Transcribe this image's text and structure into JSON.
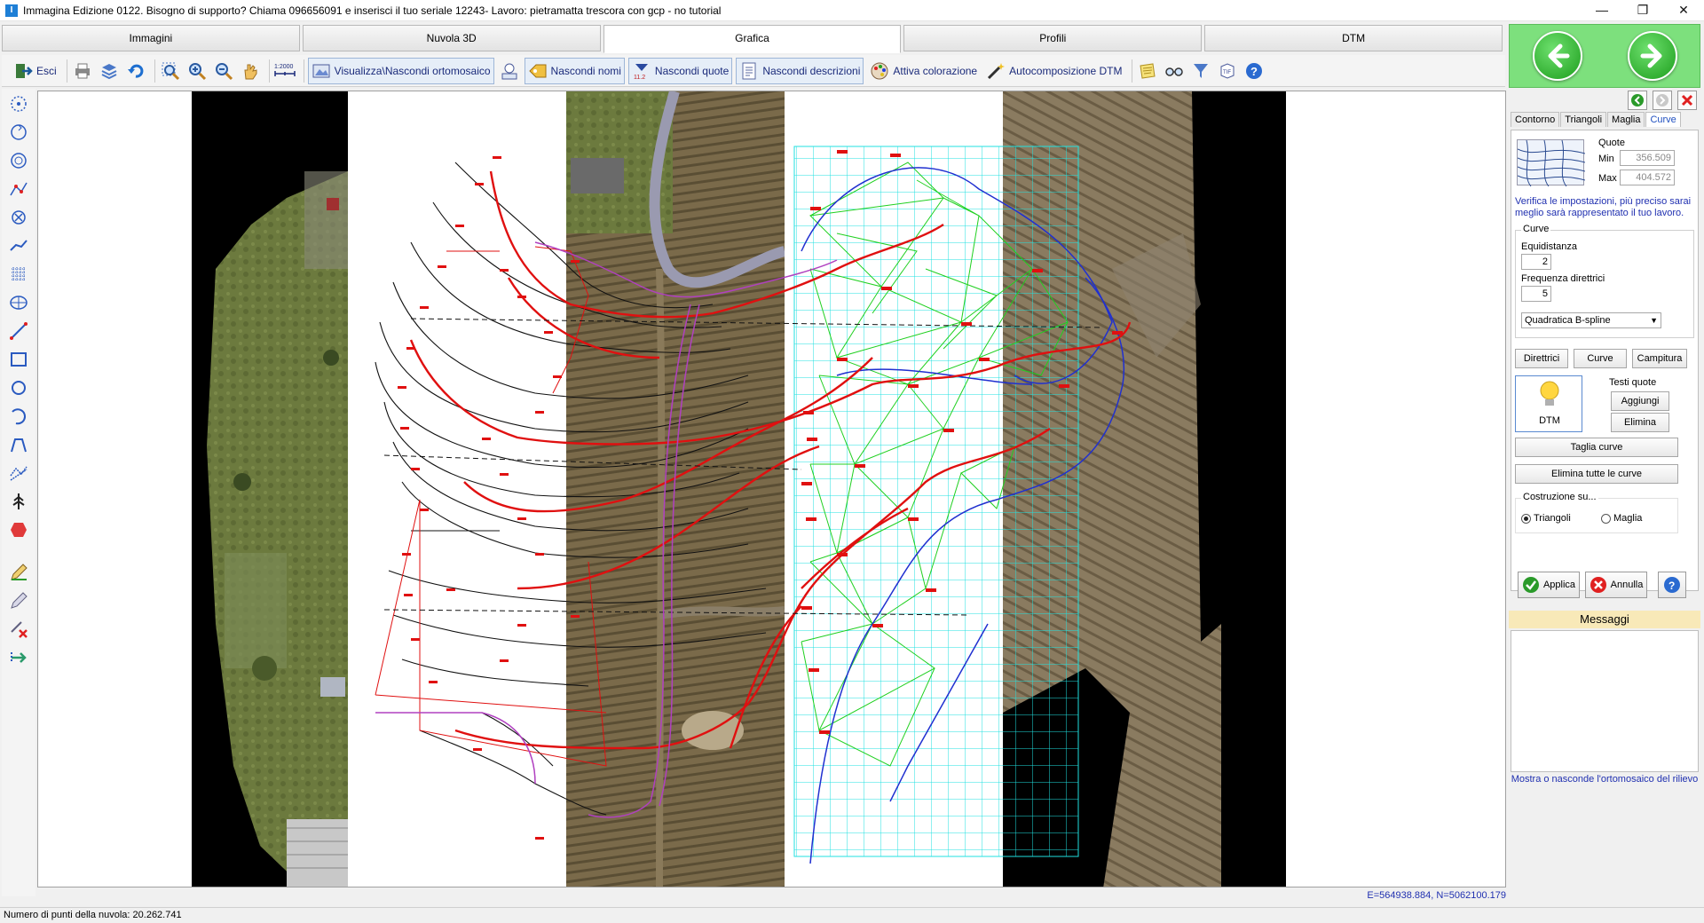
{
  "window": {
    "title": "Immagina  Edizione 0122. Bisogno di supporto? Chiama 096656091 e inserisci il tuo seriale 12243- Lavoro: pietramatta trescora con gcp - no tutorial",
    "minimize": "—",
    "maximize": "❐",
    "close": "✕"
  },
  "tabs": [
    "Immagini",
    "Nuvola 3D",
    "Grafica",
    "Profili",
    "DTM"
  ],
  "toolbar": {
    "exit": "Esci",
    "toggle_ortho": "Visualizza\\Nascondi ortomosaico",
    "hide_names": "Nascondi nomi",
    "hide_quotes": "Nascondi quote",
    "hide_desc": "Nascondi descrizioni",
    "coloring": "Attiva colorazione",
    "autocomp": "Autocomposizione DTM",
    "scale_label": "1:2000"
  },
  "right_panel": {
    "subtabs": [
      "Contorno",
      "Triangoli",
      "Maglia",
      "Curve"
    ],
    "active_subtab": "Curve",
    "quote_title": "Quote",
    "min_label": "Min",
    "min_value": "356.509",
    "max_label": "Max",
    "max_value": "404.572",
    "info": "Verifica le impostazioni, più preciso sarai meglio sarà rappresentato il tuo lavoro.",
    "curve_group": "Curve",
    "equidistanza_label": "Equidistanza",
    "equidistanza_value": "2",
    "frequenza_label": "Frequenza direttrici",
    "frequenza_value": "5",
    "spline_option": "Quadratica B-spline",
    "btn_direttrici": "Direttrici",
    "btn_curve": "Curve",
    "btn_campitura": "Campitura",
    "dtm_label": "DTM",
    "testi_title": "Testi quote",
    "btn_aggiungi": "Aggiungi",
    "btn_elimina": "Elimina",
    "btn_taglia": "Taglia curve",
    "btn_elimina_tutte": "Elimina tutte le curve",
    "costruzione_title": "Costruzione su...",
    "radio_triangoli": "Triangoli",
    "radio_maglia": "Maglia",
    "btn_applica": "Applica",
    "btn_annulla": "Annulla",
    "messages_title": "Messaggi",
    "hint": "Mostra o nasconde l'ortomosaico del rilievo"
  },
  "coords": "E=564938.884, N=5062100.179",
  "status": "Numero di punti della nuvola: 20.262.741",
  "colors": {
    "nav_panel": "#7de07d",
    "contour_major": "#e01010",
    "contour_minor": "#111111",
    "grid": "#20e0e0",
    "triangles": "#20d020",
    "boundary": "#2030d0",
    "path": "#b040c0"
  }
}
